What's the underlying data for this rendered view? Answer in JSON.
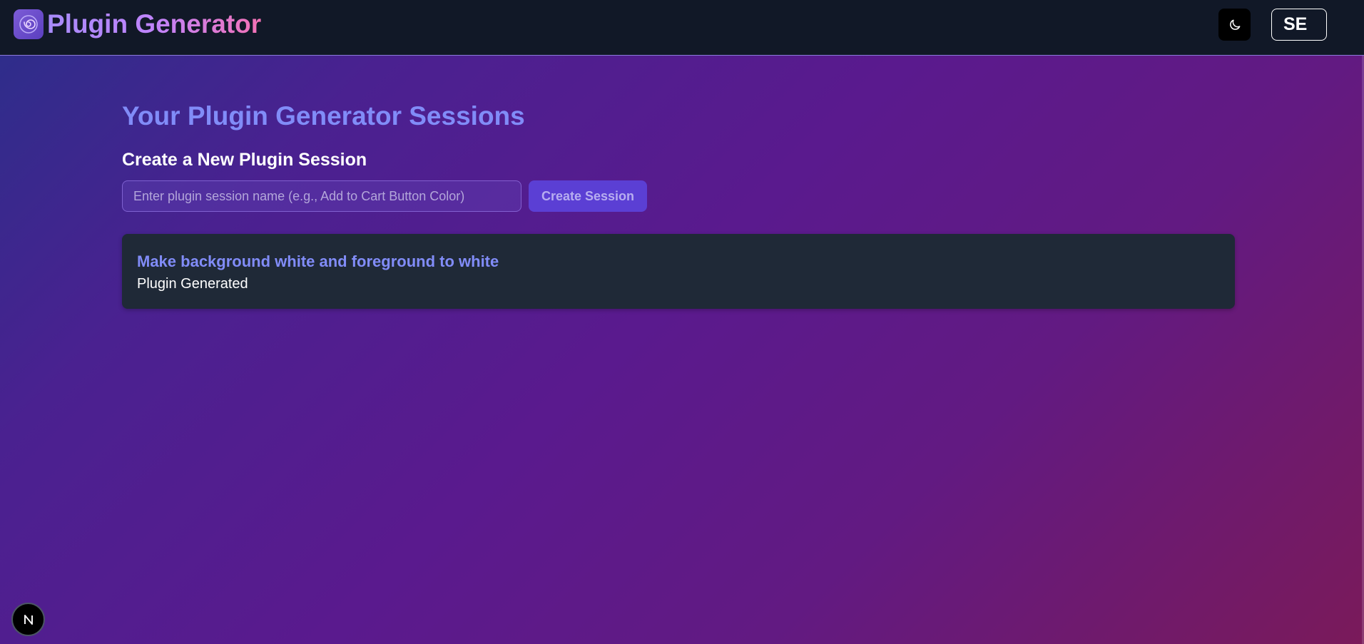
{
  "header": {
    "app_title": "Plugin Generator",
    "logo_icon": "spiral-logo-icon",
    "theme_toggle_icon": "moon-icon",
    "user_initials": "SE"
  },
  "main": {
    "page_title": "Your Plugin Generator Sessions",
    "create_section": {
      "title": "Create a New Plugin Session",
      "input_value": "",
      "input_placeholder": "Enter plugin session name (e.g., Add to Cart Button Color)",
      "button_label": "Create Session"
    },
    "sessions": [
      {
        "title": "Make background white and foreground to white",
        "status": "Plugin Generated"
      }
    ]
  },
  "dev_indicator": {
    "label": "N",
    "icon": "nextjs-logo-icon"
  },
  "colors": {
    "header_bg": "#111827",
    "accent": "#818cf8",
    "card_bg": "#1f2937",
    "button_bg": "#5b3fd4"
  }
}
